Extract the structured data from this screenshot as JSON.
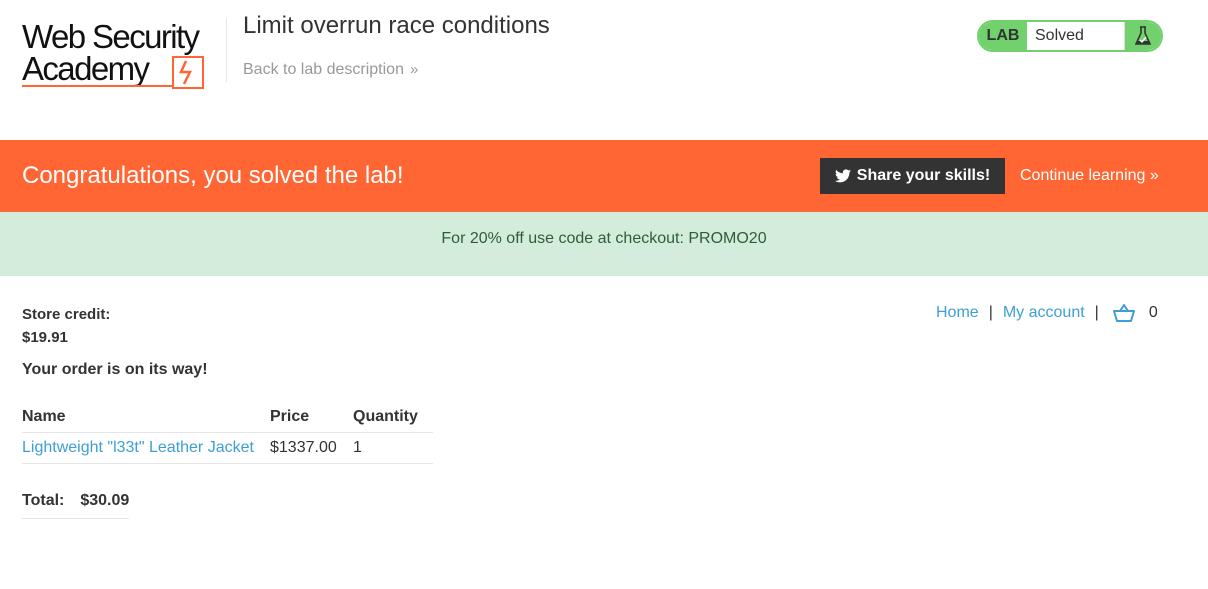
{
  "header": {
    "logo_line1": "Web Security",
    "logo_line2": "Academy",
    "lab_title": "Limit overrun race conditions",
    "back_link": "Back to lab description",
    "status_badge": "LAB",
    "status_text": "Solved"
  },
  "banner": {
    "title": "Congratulations, you solved the lab!",
    "share_label": "Share your skills!",
    "continue_label": "Continue learning"
  },
  "promo": {
    "text": "For 20% off use code at checkout: PROMO20"
  },
  "account": {
    "credit_label": "Store credit:",
    "credit_value": "$19.91",
    "order_message": "Your order is on its way!"
  },
  "nav": {
    "home": "Home",
    "sep1": "|",
    "my_account": "My account",
    "sep2": "|",
    "cart_count": "0"
  },
  "order_table": {
    "headers": [
      "Name",
      "Price",
      "Quantity"
    ],
    "rows": [
      {
        "name": "Lightweight \"l33t\" Leather Jacket",
        "price": "$1337.00",
        "quantity": "1"
      }
    ]
  },
  "total": {
    "label": "Total:",
    "value": "$30.09"
  },
  "colors": {
    "accent": "#ff6633",
    "solved_green": "#70d16d",
    "link_blue": "#3d9fd6",
    "promo_bg": "#d4ecdb"
  }
}
